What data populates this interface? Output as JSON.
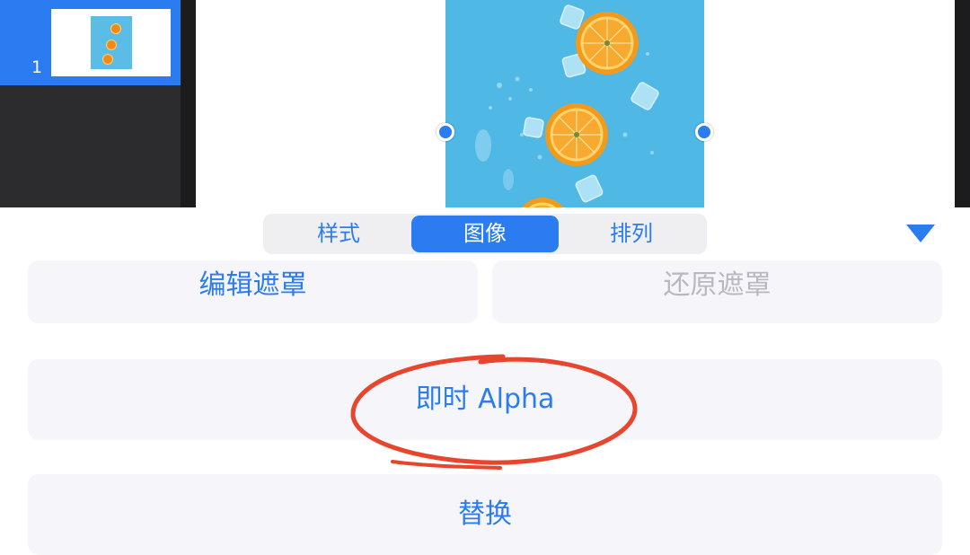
{
  "sidebar": {
    "slides": [
      {
        "number": "1",
        "selected": true
      }
    ]
  },
  "inspector": {
    "tabs": [
      {
        "label": "样式",
        "active": false
      },
      {
        "label": "图像",
        "active": true
      },
      {
        "label": "排列",
        "active": false
      }
    ],
    "collapse_icon": "triangle-down-icon",
    "buttons": {
      "edit_mask": "编辑遮罩",
      "restore_mask": "还原遮罩",
      "instant_alpha": "即时 Alpha",
      "replace": "替换"
    }
  },
  "colors": {
    "accent": "#2b7cf0",
    "annotation": "#e8452e",
    "image_background": "#4fb8e5",
    "orange": "#f28a1a"
  }
}
